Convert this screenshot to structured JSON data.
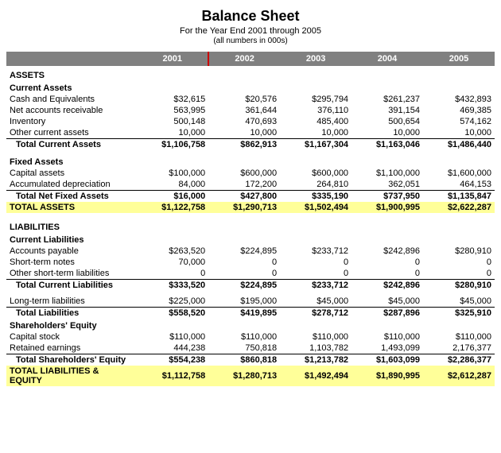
{
  "title": "Balance Sheet",
  "subtitle": "For the Year End 2001 through 2005",
  "note": "(all numbers in 000s)",
  "years": [
    "2001",
    "2002",
    "2003",
    "2004",
    "2005"
  ],
  "sections": {
    "assets_header": "ASSETS",
    "current_assets": "Current Assets",
    "cash": "Cash and Equivalents",
    "receivable": "Net accounts receivable",
    "inventory": "Inventory",
    "other_current": "Other current assets",
    "total_current": "Total Current Assets",
    "fixed_assets": "Fixed Assets",
    "capital": "Capital assets",
    "depreciation": "Accumulated depreciation",
    "total_net_fixed": "Total Net Fixed Assets",
    "total_assets": "TOTAL ASSETS",
    "liabilities_header": "LIABILITIES",
    "current_liabilities": "Current Liabilities",
    "accounts_payable": "Accounts payable",
    "short_term_notes": "Short-term notes",
    "other_short_term": "Other short-term liabilities",
    "total_current_liab": "Total Current Liabilities",
    "long_term_liab": "Long-term liabilities",
    "total_liabilities": "Total Liabilities",
    "shareholders_equity": "Shareholders' Equity",
    "capital_stock": "Capital stock",
    "retained_earnings": "Retained earnings",
    "total_shareholders": "Total Shareholders' Equity",
    "total_liab_equity": "TOTAL LIABILITIES & EQUITY"
  },
  "data": {
    "cash": [
      "$32,615",
      "$20,576",
      "$295,794",
      "$261,237",
      "$432,893"
    ],
    "receivable": [
      "563,995",
      "361,644",
      "376,110",
      "391,154",
      "469,385"
    ],
    "inventory": [
      "500,148",
      "470,693",
      "485,400",
      "500,654",
      "574,162"
    ],
    "other_current": [
      "10,000",
      "10,000",
      "10,000",
      "10,000",
      "10,000"
    ],
    "total_current": [
      "$1,106,758",
      "$862,913",
      "$1,167,304",
      "$1,163,046",
      "$1,486,440"
    ],
    "capital": [
      "$100,000",
      "$600,000",
      "$600,000",
      "$1,100,000",
      "$1,600,000"
    ],
    "depreciation": [
      "84,000",
      "172,200",
      "264,810",
      "362,051",
      "464,153"
    ],
    "total_net_fixed": [
      "$16,000",
      "$427,800",
      "$335,190",
      "$737,950",
      "$1,135,847"
    ],
    "total_assets": [
      "$1,122,758",
      "$1,290,713",
      "$1,502,494",
      "$1,900,995",
      "$2,622,287"
    ],
    "accounts_payable": [
      "$263,520",
      "$224,895",
      "$233,712",
      "$242,896",
      "$280,910"
    ],
    "short_term_notes": [
      "70,000",
      "0",
      "0",
      "0",
      "0"
    ],
    "other_short_term": [
      "0",
      "0",
      "0",
      "0",
      "0"
    ],
    "total_current_liab": [
      "$333,520",
      "$224,895",
      "$233,712",
      "$242,896",
      "$280,910"
    ],
    "long_term_liab": [
      "$225,000",
      "$195,000",
      "$45,000",
      "$45,000",
      "$45,000"
    ],
    "total_liabilities": [
      "$558,520",
      "$419,895",
      "$278,712",
      "$287,896",
      "$325,910"
    ],
    "capital_stock": [
      "$110,000",
      "$110,000",
      "$110,000",
      "$110,000",
      "$110,000"
    ],
    "retained_earnings": [
      "444,238",
      "750,818",
      "1,103,782",
      "1,493,099",
      "2,176,377"
    ],
    "total_shareholders": [
      "$554,238",
      "$860,818",
      "$1,213,782",
      "$1,603,099",
      "$2,286,377"
    ],
    "total_liab_equity": [
      "$1,112,758",
      "$1,280,713",
      "$1,492,494",
      "$1,890,995",
      "$2,612,287"
    ]
  }
}
